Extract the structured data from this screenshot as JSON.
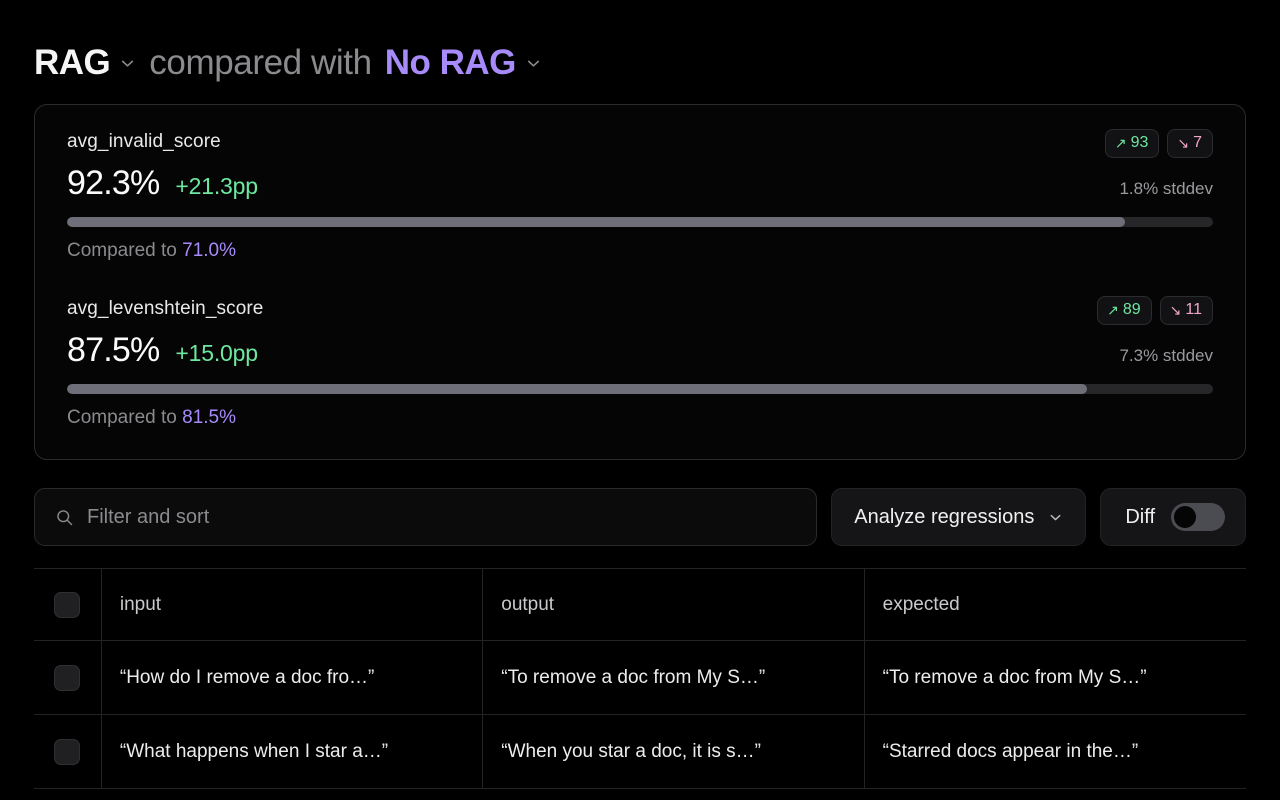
{
  "header": {
    "primary_experiment": "RAG",
    "middle_text": "compared with",
    "comparison_experiment": "No RAG",
    "chevron_icon": "chevron-down-icon"
  },
  "colors": {
    "accent_purple": "#a78bfa",
    "positive_green": "#6ee7a0",
    "negative_pink": "#f0a6c8",
    "bar_fill": "#6f6f79",
    "bar_track": "#27272a",
    "background": "#000000"
  },
  "metrics": [
    {
      "name": "avg_invalid_score",
      "value": "92.3%",
      "delta": "+21.3pp",
      "stddev": "1.8% stddev",
      "improved_badge": "93",
      "regressed_badge": "7",
      "improved_icon": "arrow-up-right-icon",
      "regressed_icon": "arrow-down-right-icon",
      "bar_percent": 92.3,
      "compared_label": "Compared to",
      "compared_value": "71.0%"
    },
    {
      "name": "avg_levenshtein_score",
      "value": "87.5%",
      "delta": "+15.0pp",
      "stddev": "7.3% stddev",
      "improved_badge": "89",
      "regressed_badge": "11",
      "improved_icon": "arrow-up-right-icon",
      "regressed_icon": "arrow-down-right-icon",
      "bar_percent": 89.0,
      "compared_label": "Compared to",
      "compared_value": "81.5%"
    }
  ],
  "toolbar": {
    "search_placeholder": "Filter and sort",
    "search_value": "",
    "search_icon": "search-icon",
    "analyze_label": "Analyze regressions",
    "analyze_chevron": "chevron-down-icon",
    "diff_label": "Diff",
    "diff_toggle_on": false
  },
  "table": {
    "columns": [
      "input",
      "output",
      "expected"
    ],
    "rows": [
      {
        "input": "“How do I remove a doc fro…”",
        "output": "“To remove a doc from My S…”",
        "expected": "“To remove a doc from My S…”"
      },
      {
        "input": "“What happens when I star a…”",
        "output": "“When you star a doc, it is s…”",
        "expected": "“Starred docs appear in the…”"
      }
    ]
  }
}
